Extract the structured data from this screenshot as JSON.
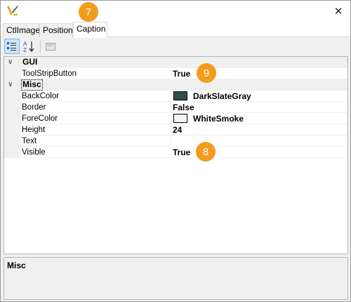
{
  "window": {
    "close_glyph": "✕"
  },
  "tabs": [
    {
      "label": "CtlImage",
      "active": false
    },
    {
      "label": "Position",
      "active": false
    },
    {
      "label": "Caption",
      "active": true
    }
  ],
  "toolbar": {
    "buttons": [
      {
        "icon": "categorized-icon",
        "pressed": true
      },
      {
        "icon": "sort-alphabetical-icon",
        "pressed": false
      },
      {
        "icon": "property-pages-icon",
        "pressed": false
      }
    ],
    "sort_glyph_top": "A",
    "sort_glyph_bottom": "Z"
  },
  "property_grid": {
    "categories": [
      {
        "label": "GUI",
        "expander": "∨",
        "properties": [
          {
            "name": "ToolStripButton",
            "value": "True"
          }
        ]
      },
      {
        "label": "Misc",
        "expander": "∨",
        "properties": [
          {
            "name": "BackColor",
            "value": "DarkSlateGray",
            "swatch": "#2f4f4f"
          },
          {
            "name": "Border",
            "value": "False"
          },
          {
            "name": "ForeColor",
            "value": "WhiteSmoke",
            "swatch": "#f5f5f5"
          },
          {
            "name": "Height",
            "value": "24"
          },
          {
            "name": "Text",
            "value": ""
          },
          {
            "name": "Visible",
            "value": "True"
          }
        ]
      }
    ]
  },
  "description": {
    "title": "Misc"
  },
  "badges": {
    "tab": "7",
    "toolstrip": "9",
    "visible": "8"
  },
  "colors": {
    "badge": "#f29b1c",
    "selected_toolbar": "#cce4f7",
    "accent_icon": "#e8a317"
  }
}
